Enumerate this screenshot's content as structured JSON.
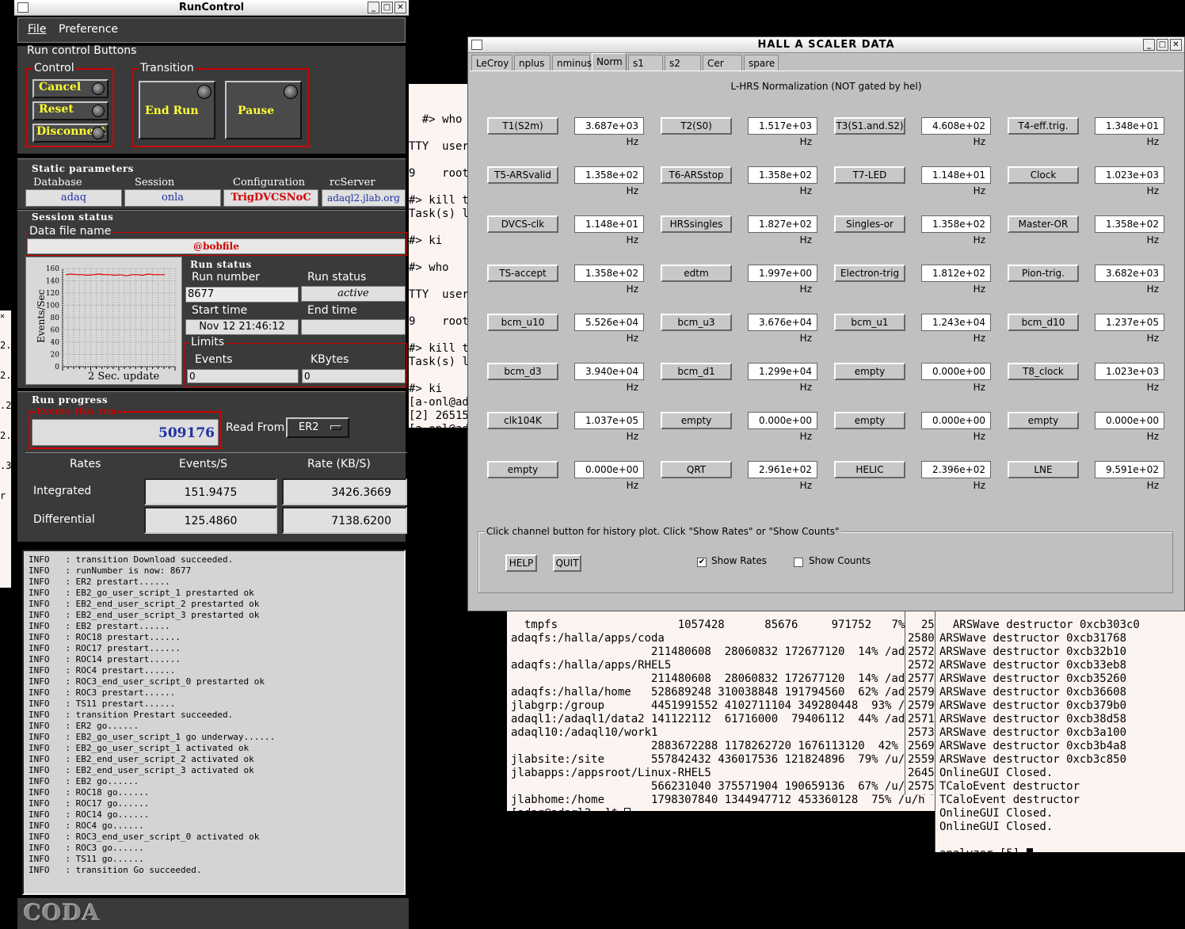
{
  "runcontrol": {
    "title": "RunControl",
    "menu": [
      "File",
      "Preference"
    ],
    "rc_buttons_label": "Run control Buttons",
    "control_label": "Control",
    "transition_label": "Transition",
    "cancel": "Cancel",
    "reset": "Reset",
    "disconnect": "Disconnect",
    "end_run": "End Run",
    "pause": "Pause",
    "static_label": "Static parameters",
    "database_label": "Database",
    "database": "adaq",
    "session_label": "Session",
    "session": "onla",
    "config_label": "Configuration",
    "config": "TrigDVCSNoC",
    "server_label": "rcServer",
    "server": "adaql2.jlab.org",
    "session_status": "Session status",
    "data_file_label": "Data file name",
    "data_file": "@bobfile",
    "graph_ylabel": "Events/Sec",
    "graph_update": "2 Sec. update",
    "graph_ticks": [
      "160",
      "140",
      "120",
      "100",
      "80",
      "60",
      "40",
      "20",
      "0"
    ],
    "run_status_label": "Run status",
    "run_number_label": "Run number",
    "run_number": "8677",
    "run_status_field_label": "Run status",
    "run_status": "active",
    "start_time_label": "Start time",
    "start_time": "Nov 12 21:46:12",
    "end_time_label": "End time",
    "end_time": "",
    "limits_label": "Limits",
    "events_label": "Events",
    "events_limit": "0",
    "kbytes_label": "KBytes",
    "kbytes_limit": "0",
    "progress_label": "Run progress",
    "events_this_run_label": "Events this run",
    "events_this_run": "509176",
    "read_from_label": "Read From:",
    "read_from": "ER2",
    "rates_hdr": "Rates",
    "events_s_hdr": "Events/S",
    "rate_kbs_hdr": "Rate (KB/S)",
    "integrated_label": "Integrated",
    "integrated_events": "151.9475",
    "integrated_rate": "3426.3669",
    "differential_label": "Differential",
    "differential_events": "125.4860",
    "differential_rate": "7138.6200",
    "log": [
      "INFO   : transition Download succeeded.",
      "INFO   : runNumber is now: 8677",
      "INFO   : ER2 prestart......",
      "INFO   : EB2_go_user_script_1 prestarted ok",
      "INFO   : EB2_end_user_script_2 prestarted ok",
      "INFO   : EB2_end_user_script_3 prestarted ok",
      "INFO   : EB2 prestart......",
      "INFO   : ROC18 prestart......",
      "INFO   : ROC17 prestart......",
      "INFO   : ROC14 prestart......",
      "INFO   : ROC4 prestart......",
      "INFO   : ROC3_end_user_script_0 prestarted ok",
      "INFO   : ROC3 prestart......",
      "INFO   : TS11 prestart......",
      "INFO   : transition Prestart succeeded.",
      "INFO   : ER2 go......",
      "INFO   : EB2_go_user_script_1 go underway......",
      "INFO   : EB2_go_user_script_1 activated ok",
      "INFO   : EB2_end_user_script_2 activated ok",
      "INFO   : EB2_end_user_script_3 activated ok",
      "INFO   : EB2 go......",
      "INFO   : ROC18 go......",
      "INFO   : ROC17 go......",
      "INFO   : ROC14 go......",
      "INFO   : ROC4 go......",
      "INFO   : ROC3_end_user_script_0 activated ok",
      "INFO   : ROC3 go......",
      "INFO   : TS11 go......",
      "INFO   : transition Go succeeded."
    ],
    "logo": "CODA"
  },
  "scaler": {
    "title": "HALL  A  SCALER  DATA",
    "tabs": [
      "LeCroy",
      "nplus",
      "nminus",
      "Norm",
      "s1",
      "s2",
      "Cer",
      "spare"
    ],
    "active_tab": "Norm",
    "heading": "L-HRS Normalization (NOT gated by hel)",
    "channels": [
      {
        "name": "T1(S2m)",
        "value": "3.687e+03 Hz"
      },
      {
        "name": "T2(S0)",
        "value": "1.517e+03 Hz"
      },
      {
        "name": "T3(S1.and.S2)",
        "value": "4.608e+02 Hz"
      },
      {
        "name": "T4-eff.trig.",
        "value": "1.348e+01 Hz"
      },
      {
        "name": "T5-ARSvalid",
        "value": "1.358e+02 Hz"
      },
      {
        "name": "T6-ARSstop",
        "value": "1.358e+02 Hz"
      },
      {
        "name": "T7-LED",
        "value": "1.148e+01 Hz"
      },
      {
        "name": "Clock",
        "value": "1.023e+03 Hz"
      },
      {
        "name": "DVCS-clk",
        "value": "1.148e+01 Hz"
      },
      {
        "name": "HRSsingles",
        "value": "1.827e+02 Hz"
      },
      {
        "name": "Singles-or",
        "value": "1.358e+02 Hz"
      },
      {
        "name": "Master-OR",
        "value": "1.358e+02 Hz"
      },
      {
        "name": "TS-accept",
        "value": "1.358e+02 Hz"
      },
      {
        "name": "edtm",
        "value": "1.997e+00 Hz"
      },
      {
        "name": "Electron-trig",
        "value": "1.812e+02 Hz"
      },
      {
        "name": "Pion-trig.",
        "value": "3.682e+03 Hz"
      },
      {
        "name": "bcm_u10",
        "value": "5.526e+04 Hz"
      },
      {
        "name": "bcm_u3",
        "value": "3.676e+04 Hz"
      },
      {
        "name": "bcm_u1",
        "value": "1.243e+04 Hz"
      },
      {
        "name": "bcm_d10",
        "value": "1.237e+05 Hz"
      },
      {
        "name": "bcm_d3",
        "value": "3.940e+04 Hz"
      },
      {
        "name": "bcm_d1",
        "value": "1.299e+04 Hz"
      },
      {
        "name": "empty",
        "value": "0.000e+00 Hz"
      },
      {
        "name": "T8_clock",
        "value": "1.023e+03 Hz"
      },
      {
        "name": "clk104K",
        "value": "1.037e+05 Hz"
      },
      {
        "name": "empty",
        "value": "0.000e+00 Hz"
      },
      {
        "name": "empty",
        "value": "0.000e+00 Hz"
      },
      {
        "name": "empty",
        "value": "0.000e+00 Hz"
      },
      {
        "name": "empty",
        "value": "0.000e+00 Hz"
      },
      {
        "name": "QRT",
        "value": "2.961e+02 Hz"
      },
      {
        "name": "HELIC",
        "value": "2.396e+02 Hz"
      },
      {
        "name": "LNE",
        "value": "9.591e+02 Hz"
      }
    ],
    "hint": "Click channel button for history plot.  Click \"Show Rates\" or \"Show Counts\"",
    "help": "HELP",
    "quit": "QUIT",
    "show_rates": "Show Rates",
    "show_counts": "Show Counts"
  },
  "term_middle": "#> who\n\nTTY  user\n\n9    root\n\n#> kill t\nTask(s) l\n\n#> ki\n\n#> who\n\nTTY  user\n\n9    root\n\n#> kill t\nTask(s) l\n\n#> ki\n[a-onl@ad\n[2] 26515\n[a-onl@ad",
  "term_df": "tmpfs                  1057428      85676     971752   7% /tmp\nadaqfs:/halla/apps/coda\n                     211480608  28060832 172677120  14% /adaqf\nadaqfs:/halla/apps/RHEL5\n                     211480608  28060832 172677120  14% /adaqf\nadaqfs:/halla/home   528689248 310038848 191794560  62% /adaqf\njlabgrp:/group       4451991552 4102711104 349280448  93% /u/g\nadaql1:/adaql1/data2 141122112  61716000  79406112  44% /adaql\nadaql10:/adaql10/work1\n                     2883672288 1178262720 1676113120  42% /ad\njlabsite:/site       557842432 436017536 121824896  79% /u/sit\njlabapps:/appsroot/Linux-RHEL5\n                     566231040 375571904 190659136  67% /u/app\njlabhome:/home       1798307840 1344947712 453360128  75% /u/h\n[adaq@adaql2 ~]$ ",
  "term_nums": "258\n2580\n2572\n2572\n2577\n2579\n2579\n2571\n2573\n2569\n2559\n2645\n2575\n 296",
  "term_analyzer": "ARSWave destructor 0xcb303c0\nARSWave destructor 0xcb31768\nARSWave destructor 0xcb32b10\nARSWave destructor 0xcb33eb8\nARSWave destructor 0xcb35260\nARSWave destructor 0xcb36608\nARSWave destructor 0xcb379b0\nARSWave destructor 0xcb38d58\nARSWave destructor 0xcb3a100\nARSWave destructor 0xcb3b4a8\nARSWave destructor 0xcb3c850\nOnlineGUI Closed.\nTCaloEvent destructor\nTCaloEvent destructor\nOnlineGUI Closed.\nOnlineGUI Closed.\n\nanalyzer [5] ",
  "term_left": " \n2.\n \n2.\n \n.2\n \n2.\n \n.3\n \nr",
  "graph_series": [
    150,
    151,
    150,
    150,
    149,
    150,
    151,
    150,
    150,
    149,
    150,
    148,
    150,
    150,
    149,
    151,
    150,
    150,
    150
  ]
}
